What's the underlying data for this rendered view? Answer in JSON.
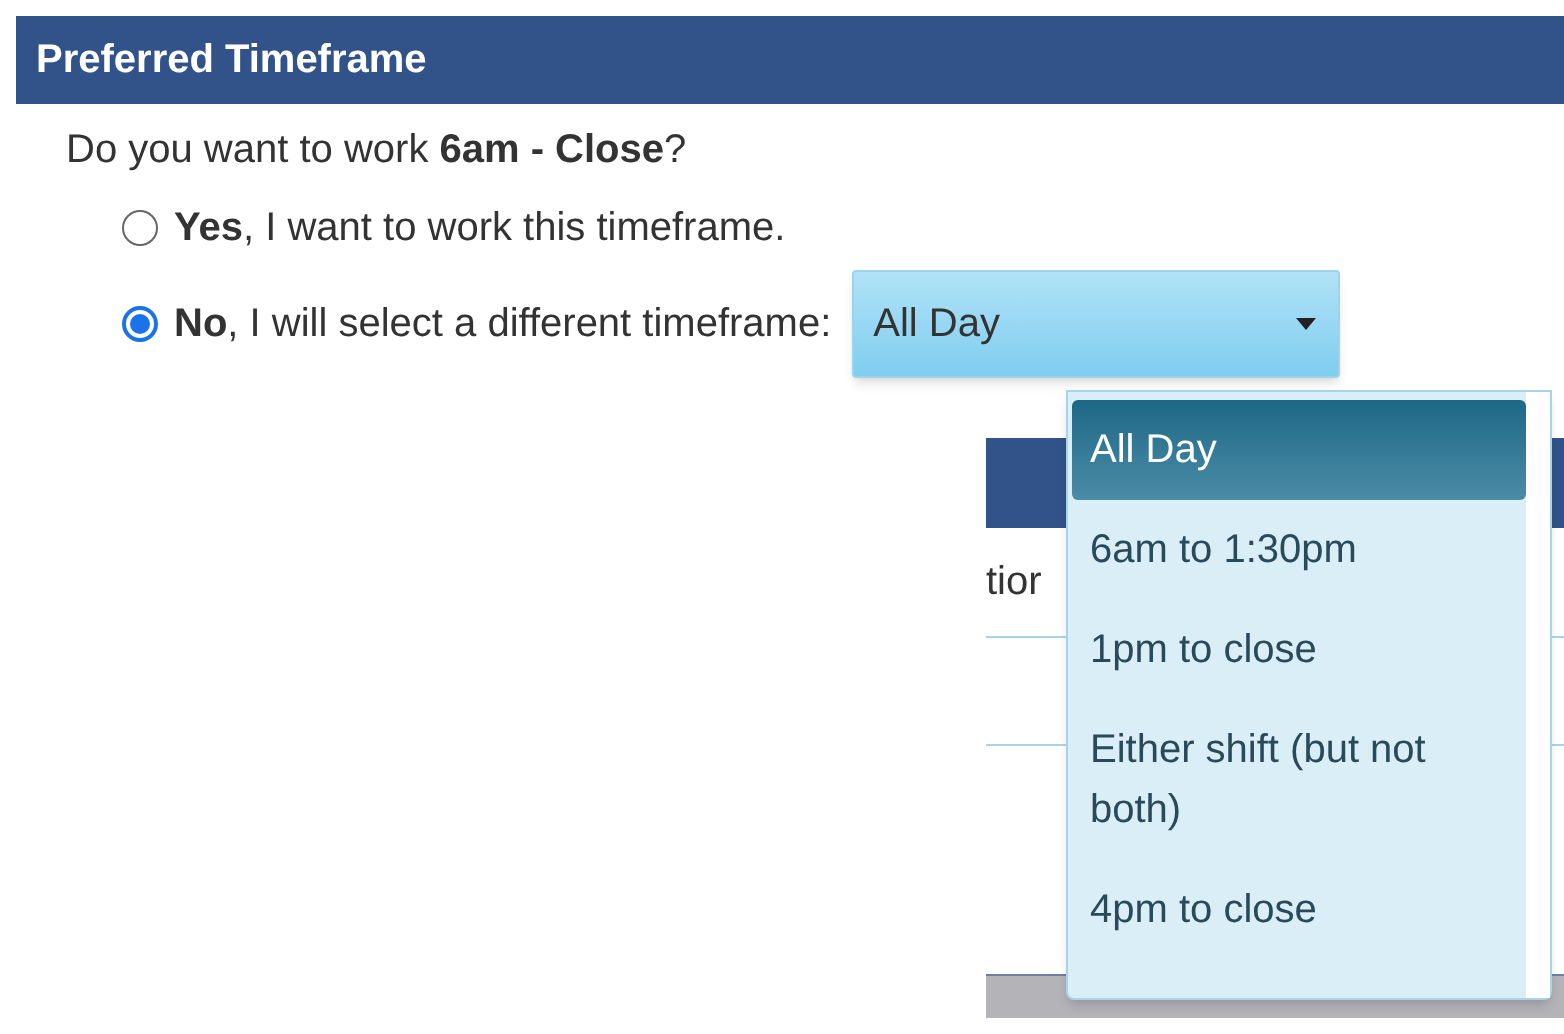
{
  "section": {
    "title": "Preferred Timeframe"
  },
  "question": "Do you want to work **6am - Close**?",
  "options": [
    {
      "label": "**Yes**, I want to work this timeframe.",
      "selected": false
    },
    {
      "label": "**No**, I will select a different timeframe:",
      "selected": true
    }
  ],
  "timeframe_select": {
    "value": "All Day",
    "expanded": true,
    "items": [
      {
        "label": "All Day",
        "selected": true
      },
      {
        "label": "6am to 1:30pm",
        "selected": false
      },
      {
        "label": "1pm to close",
        "selected": false
      },
      {
        "label": "Either shift (but not both)",
        "selected": false
      },
      {
        "label": "4pm to close",
        "selected": false
      }
    ]
  },
  "background_table": {
    "column_1": "tior"
  }
}
